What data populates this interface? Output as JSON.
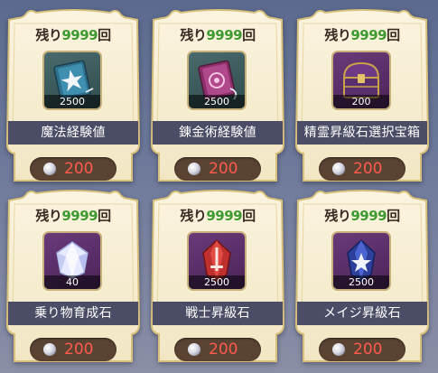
{
  "remain_prefix": "残り",
  "remain_suffix": "回",
  "currency_icon": "pearl-icon",
  "colors": {
    "price": "#ff5a4e",
    "remain_count": "#3e9a30",
    "name_bar": "#4b4d66"
  },
  "items": [
    {
      "remain_count": "9999",
      "name": "魔法経験値",
      "count": "2500",
      "price": "200",
      "icon": "blue-star-book-icon"
    },
    {
      "remain_count": "9999",
      "name": "錬金術経験値",
      "count": "2500",
      "price": "200",
      "icon": "pink-book-icon"
    },
    {
      "remain_count": "9999",
      "name": "精霊昇級石選択宝箱",
      "count": "200",
      "price": "200",
      "icon": "treasure-chest-icon"
    },
    {
      "remain_count": "9999",
      "name": "乗り物育成石",
      "count": "40",
      "price": "200",
      "icon": "white-crystal-icon"
    },
    {
      "remain_count": "9999",
      "name": "戦士昇級石",
      "count": "2500",
      "price": "200",
      "icon": "red-sword-gem-icon"
    },
    {
      "remain_count": "9999",
      "name": "メイジ昇級石",
      "count": "2500",
      "price": "200",
      "icon": "blue-star-gem-icon"
    }
  ]
}
